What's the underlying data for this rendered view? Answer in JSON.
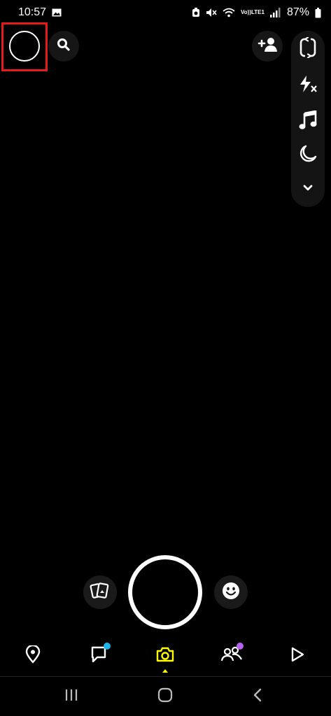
{
  "status_bar": {
    "time": "10:57",
    "battery": "87%",
    "volte_label_top": "Vo))",
    "volte_label_bottom": "LTE1",
    "icons": [
      "gallery-icon",
      "alarm-icon",
      "mute-icon",
      "wifi-icon",
      "signal-icon",
      "battery-icon"
    ]
  },
  "top_bar": {
    "profile": "avatar",
    "search": "search-icon",
    "add_friend": "add-friend-icon"
  },
  "camera_tools": [
    "flip-camera-icon",
    "flash-off-icon",
    "music-icon",
    "night-mode-icon",
    "chevron-down-icon"
  ],
  "capture": {
    "memories": "memories-icon",
    "lens": "smiley-icon"
  },
  "bottom_nav": {
    "items": [
      "map-pin-icon",
      "chat-icon",
      "camera-icon",
      "friends-icon",
      "spotlight-icon"
    ],
    "active": "camera-icon",
    "colors": {
      "active": "#fffc00",
      "chat_badge": "#20b3e8",
      "friends_badge": "#b860f2",
      "highlight_box": "#e41b1b"
    }
  },
  "system_nav": [
    "recents-icon",
    "home-icon",
    "back-icon"
  ]
}
